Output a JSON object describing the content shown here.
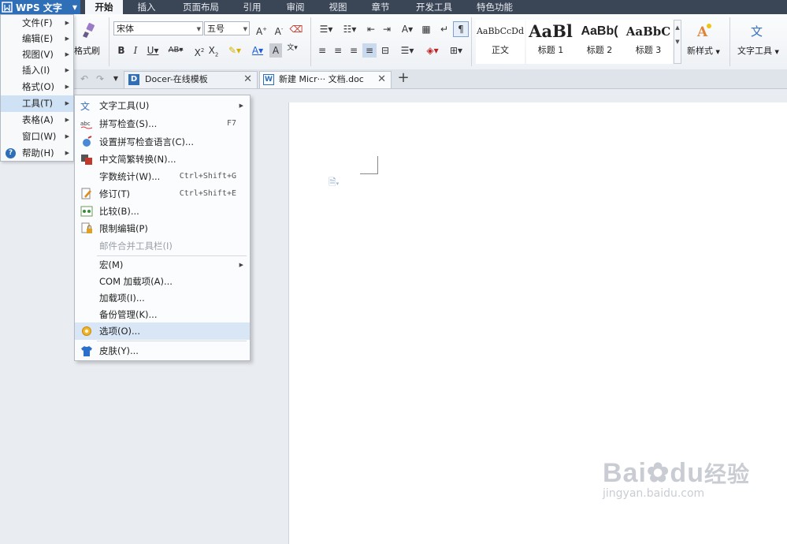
{
  "app": {
    "name": "WPS 文字"
  },
  "ribbon_tabs": [
    "开始",
    "插入",
    "页面布局",
    "引用",
    "审阅",
    "视图",
    "章节",
    "开发工具",
    "特色功能"
  ],
  "ribbon": {
    "format_painter": "格式刷",
    "font_name": "宋体",
    "font_size": "五号",
    "styles": [
      {
        "sample": "AaBbCcDd",
        "label": "正文"
      },
      {
        "sample": "AaBl",
        "label": "标题 1"
      },
      {
        "sample": "AaBb(",
        "label": "标题 2"
      },
      {
        "sample": "AaBbC",
        "label": "标题 3"
      }
    ],
    "new_style": "新样式",
    "text_tools": "文字工具"
  },
  "doc_tabs": [
    {
      "label": "Docer-在线模板"
    },
    {
      "label": "新建 Micr··· 文档.doc"
    }
  ],
  "main_menu": [
    {
      "label": "文件(F)"
    },
    {
      "label": "编辑(E)"
    },
    {
      "label": "视图(V)"
    },
    {
      "label": "插入(I)"
    },
    {
      "label": "格式(O)"
    },
    {
      "label": "工具(T)"
    },
    {
      "label": "表格(A)"
    },
    {
      "label": "窗口(W)"
    },
    {
      "label": "帮助(H)"
    }
  ],
  "tools_menu": [
    {
      "label": "文字工具(U)",
      "shortcut": ""
    },
    {
      "label": "拼写检查(S)...",
      "shortcut": "F7"
    },
    {
      "label": "设置拼写检查语言(C)...",
      "shortcut": ""
    },
    {
      "label": "中文简繁转换(N)...",
      "shortcut": ""
    },
    {
      "label": "字数统计(W)...",
      "shortcut": "Ctrl+Shift+G"
    },
    {
      "label": "修订(T)",
      "shortcut": "Ctrl+Shift+E"
    },
    {
      "label": "比较(B)...",
      "shortcut": ""
    },
    {
      "label": "限制编辑(P)",
      "shortcut": ""
    },
    {
      "label": "邮件合并工具栏(I)",
      "shortcut": ""
    },
    {
      "label": "宏(M)",
      "shortcut": ""
    },
    {
      "label": "COM 加载项(A)...",
      "shortcut": ""
    },
    {
      "label": "加载项(I)...",
      "shortcut": ""
    },
    {
      "label": "备份管理(K)...",
      "shortcut": ""
    },
    {
      "label": "选项(O)...",
      "shortcut": ""
    },
    {
      "label": "皮肤(Y)...",
      "shortcut": ""
    }
  ],
  "watermark": {
    "brand": "Bai",
    "brand2": "du",
    "cn": "经验",
    "url": "jingyan.baidu.com"
  },
  "colors": {
    "accent": "#2f6fb7",
    "menubar": "#3a4556",
    "highlight": "#d8e6f6"
  }
}
